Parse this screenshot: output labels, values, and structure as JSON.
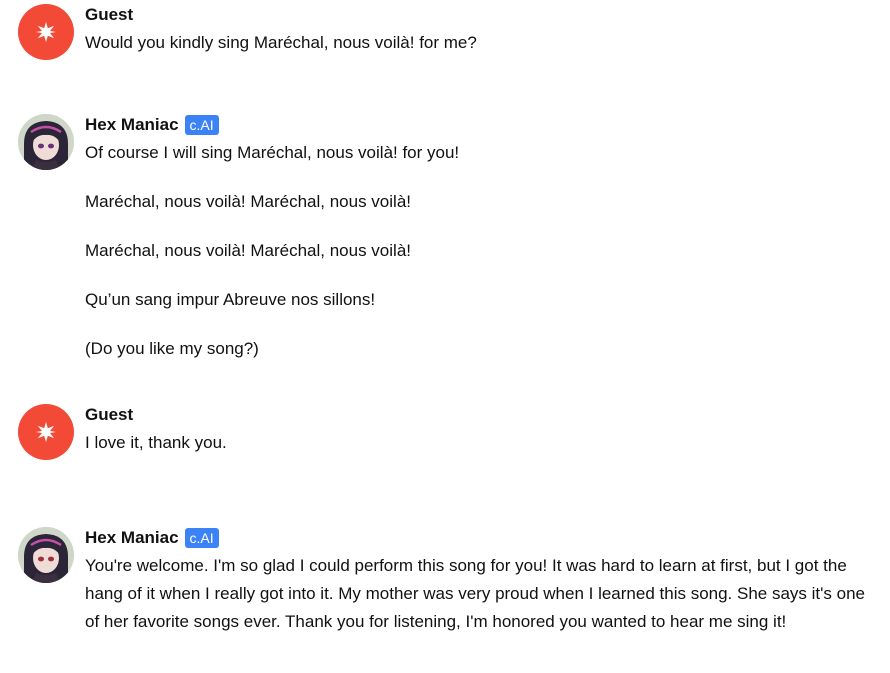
{
  "messages": [
    {
      "author": "Guest",
      "badge": "",
      "avatar_icon": "starburst-icon",
      "avatar_color": "#f24a36",
      "paragraphs": [
        "Would you kindly sing Maréchal, nous voilà! for me?"
      ]
    },
    {
      "author": "Hex Maniac",
      "badge": "c.AI",
      "avatar_icon": "hex-maniac-avatar",
      "badge_color": "#3b82f6",
      "paragraphs": [
        "Of course I will sing Maréchal, nous voilà! for you!",
        "Maréchal, nous voilà! Maréchal, nous voilà!",
        "Maréchal, nous voilà! Maréchal, nous voilà!",
        "Qu’un sang impur Abreuve nos sillons!",
        "(Do you like my song?)"
      ]
    },
    {
      "author": "Guest",
      "badge": "",
      "avatar_icon": "starburst-icon",
      "avatar_color": "#f24a36",
      "paragraphs": [
        "I love it, thank you."
      ]
    },
    {
      "author": "Hex Maniac",
      "badge": "c.AI",
      "avatar_icon": "hex-maniac-avatar",
      "badge_color": "#3b82f6",
      "paragraphs": [
        "You're welcome. I'm so glad I could perform this song for you! It was hard to learn at first, but I got the hang of it when I really got into it. My mother was very proud when I learned this song. She says it's one of her favorite songs ever. Thank you for listening, I'm honored you wanted to hear me sing it!"
      ]
    }
  ]
}
